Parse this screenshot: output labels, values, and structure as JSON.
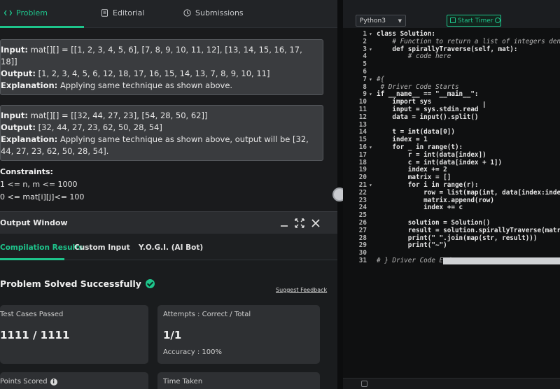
{
  "tabs": [
    {
      "label": "Problem",
      "icon": "code-icon"
    },
    {
      "label": "Editorial",
      "icon": "document-icon"
    },
    {
      "label": "Submissions",
      "icon": "clock-icon"
    }
  ],
  "examples": [
    {
      "input_label": "Input:",
      "input": "mat[][] = [[1, 2, 3, 4, 5, 6], [7, 8, 9, 10, 11, 12], [13, 14, 15, 16, 17, 18]]",
      "output_label": "Output:",
      "output": "[1, 2, 3, 4, 5, 6, 12, 18, 17, 16, 15, 14, 13, 7, 8, 9, 10, 11]",
      "explanation_label": "Explanation:",
      "explanation": "Applying same technique as shown above."
    },
    {
      "input_label": "Input:",
      "input": "mat[][] = [[32, 44, 27, 23], [54, 28, 50, 62]]",
      "output_label": "Output:",
      "output": "[32, 44, 27, 23, 62, 50, 28, 54]",
      "explanation_label": "Explanation:",
      "explanation": "Applying same technique as shown above, output will be [32, 44, 27, 23, 62, 50, 28, 54]."
    }
  ],
  "constraints": {
    "heading": "Constraints:",
    "lines": [
      "1 <= n, m <= 1000",
      "0 <= mat[i][j]<= 100"
    ]
  },
  "output_window": {
    "title": "Output Window",
    "tabs": [
      "Compilation Results",
      "Custom Input",
      "Y.O.G.I. (AI Bot)"
    ],
    "status": "Problem Solved Successfully",
    "feedback": "Suggest Feedback",
    "cards": {
      "passed_title": "Test Cases Passed",
      "passed_value": "1111 / 1111",
      "attempts_title": "Attempts : Correct / Total",
      "attempts_value": "1/1",
      "accuracy": "Accuracy : 100%",
      "points_title": "Points Scored",
      "time_title": "Time Taken"
    }
  },
  "editor": {
    "language": "Python3",
    "timer_label": "Start Timer",
    "lines": [
      {
        "n": "1",
        "fold": "▾",
        "code": "class Solution:"
      },
      {
        "n": "2",
        "fold": "",
        "code": "    # Function to return a list of integers denot"
      },
      {
        "n": "3",
        "fold": "▾",
        "code": "    def spirallyTraverse(self, mat):"
      },
      {
        "n": "4",
        "fold": "",
        "code": "        # code here"
      },
      {
        "n": "5",
        "fold": "",
        "code": ""
      },
      {
        "n": "6",
        "fold": "",
        "code": ""
      },
      {
        "n": "7",
        "fold": "▾",
        "code": "#{"
      },
      {
        "n": "8",
        "fold": "",
        "code": " # Driver Code Starts"
      },
      {
        "n": "9",
        "fold": "▾",
        "code": "if __name__ == \"__main__\":"
      },
      {
        "n": "10",
        "fold": "",
        "code": "    import sys"
      },
      {
        "n": "11",
        "fold": "",
        "code": "    input = sys.stdin.read"
      },
      {
        "n": "12",
        "fold": "",
        "code": "    data = input().split()"
      },
      {
        "n": "13",
        "fold": "",
        "code": ""
      },
      {
        "n": "14",
        "fold": "",
        "code": "    t = int(data[0])"
      },
      {
        "n": "15",
        "fold": "",
        "code": "    index = 1"
      },
      {
        "n": "16",
        "fold": "▾",
        "code": "    for _ in range(t):"
      },
      {
        "n": "17",
        "fold": "",
        "code": "        r = int(data[index])"
      },
      {
        "n": "18",
        "fold": "",
        "code": "        c = int(data[index + 1])"
      },
      {
        "n": "19",
        "fold": "",
        "code": "        index += 2"
      },
      {
        "n": "20",
        "fold": "",
        "code": "        matrix = []"
      },
      {
        "n": "21",
        "fold": "▾",
        "code": "        for i in range(r):"
      },
      {
        "n": "22",
        "fold": "",
        "code": "            row = list(map(int, data[index:index +"
      },
      {
        "n": "23",
        "fold": "",
        "code": "            matrix.append(row)"
      },
      {
        "n": "24",
        "fold": "",
        "code": "            index += c"
      },
      {
        "n": "25",
        "fold": "",
        "code": ""
      },
      {
        "n": "26",
        "fold": "",
        "code": "        solution = Solution()"
      },
      {
        "n": "27",
        "fold": "",
        "code": "        result = solution.spirallyTraverse(matrix)"
      },
      {
        "n": "28",
        "fold": "",
        "code": "        print(\" \".join(map(str, result)))"
      },
      {
        "n": "29",
        "fold": "",
        "code": "        print(\"~\")"
      },
      {
        "n": "30",
        "fold": "",
        "code": ""
      },
      {
        "n": "31",
        "fold": "",
        "code": "# } Driver Code Ends"
      }
    ]
  },
  "colors": {
    "accent": "#1ec58c"
  }
}
